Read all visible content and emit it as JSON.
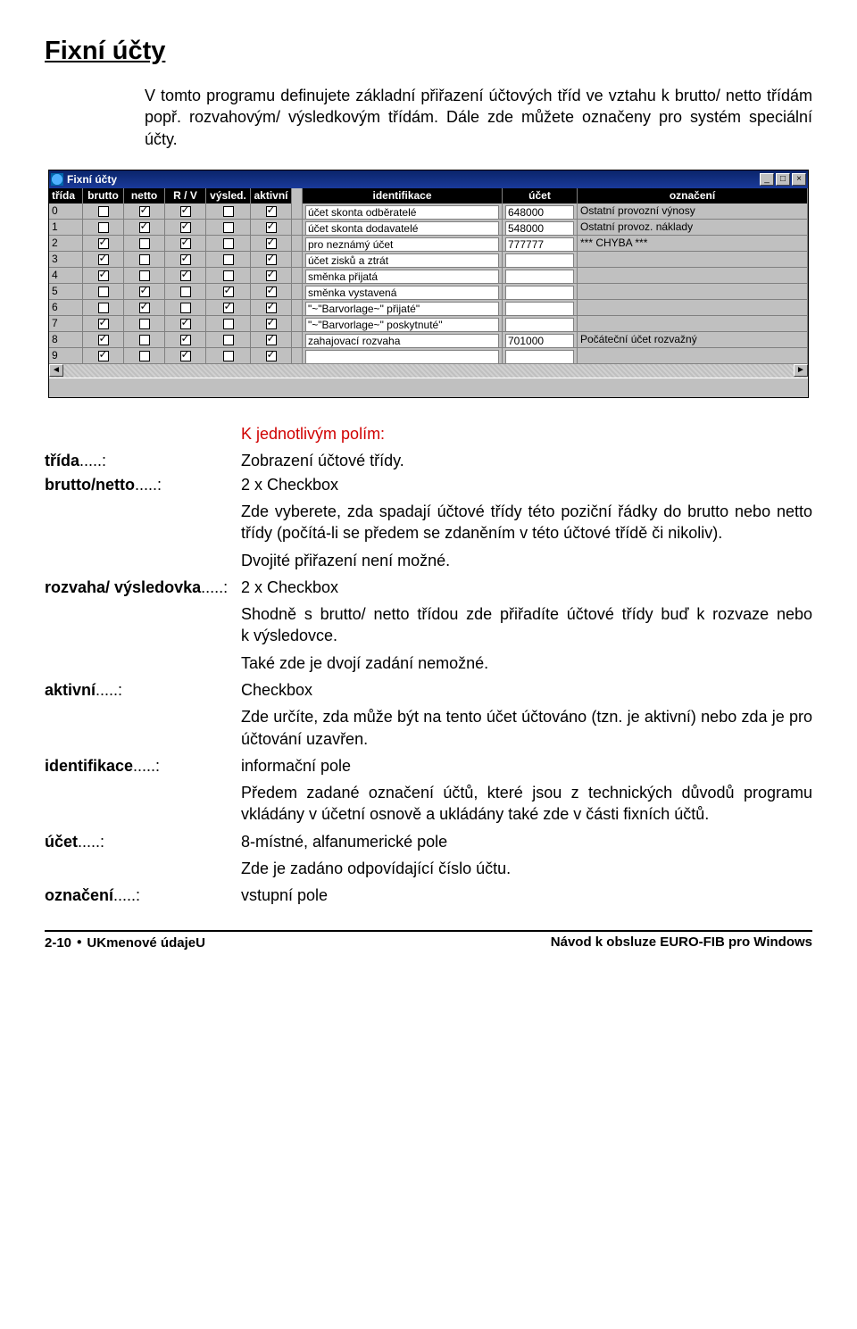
{
  "heading": "Fixní účty",
  "intro": "V tomto programu definujete základní přiřazení účtových tříd ve vztahu k brutto/ netto třídám popř. rozvahovým/ výsledkovým třídám. Dále zde můžete označeny pro systém speciální účty.",
  "window": {
    "title": "Fixní účty",
    "headers": {
      "trida": "třída",
      "brutto": "brutto",
      "netto": "netto",
      "rv": "R / V",
      "vysled": "výsled.",
      "aktivni": "aktivní",
      "ident": "identifikace",
      "ucet": "účet",
      "oznaceni": "označení"
    },
    "rows": [
      {
        "t": "0",
        "b": 0,
        "n": 1,
        "r": 1,
        "v": 0,
        "a": 1,
        "id": "účet skonta odběratelé",
        "uc": "648000",
        "oz": "Ostatní provozní výnosy"
      },
      {
        "t": "1",
        "b": 0,
        "n": 1,
        "r": 1,
        "v": 0,
        "a": 1,
        "id": "účet skonta dodavatelé",
        "uc": "548000",
        "oz": "Ostatní provoz. náklady"
      },
      {
        "t": "2",
        "b": 1,
        "n": 0,
        "r": 1,
        "v": 0,
        "a": 1,
        "id": "pro neznámý účet",
        "uc": "777777",
        "oz": "*** CHYBA ***"
      },
      {
        "t": "3",
        "b": 1,
        "n": 0,
        "r": 1,
        "v": 0,
        "a": 1,
        "id": "účet zisků a ztrát",
        "uc": "",
        "oz": ""
      },
      {
        "t": "4",
        "b": 1,
        "n": 0,
        "r": 1,
        "v": 0,
        "a": 1,
        "id": "směnka přijatá",
        "uc": "",
        "oz": ""
      },
      {
        "t": "5",
        "b": 0,
        "n": 1,
        "r": 0,
        "v": 1,
        "a": 1,
        "id": "směnka vystavená",
        "uc": "",
        "oz": ""
      },
      {
        "t": "6",
        "b": 0,
        "n": 1,
        "r": 0,
        "v": 1,
        "a": 1,
        "id": "\"~\"Barvorlage~\" přijaté\"",
        "uc": "",
        "oz": ""
      },
      {
        "t": "7",
        "b": 1,
        "n": 0,
        "r": 1,
        "v": 0,
        "a": 1,
        "id": "\"~\"Barvorlage~\" poskytnuté\"",
        "uc": "",
        "oz": ""
      },
      {
        "t": "8",
        "b": 1,
        "n": 0,
        "r": 1,
        "v": 0,
        "a": 1,
        "id": "zahajovací rozvaha",
        "uc": "701000",
        "oz": "Počáteční účet rozvažný"
      },
      {
        "t": "9",
        "b": 1,
        "n": 0,
        "r": 1,
        "v": 0,
        "a": 1,
        "id": "",
        "uc": "",
        "oz": ""
      }
    ]
  },
  "defs_heading": "K jednotlivým polím:",
  "defs": {
    "trida": {
      "term": "třída",
      "dots": ".....: ",
      "desc": "Zobrazení účtové třídy."
    },
    "bn": {
      "term": "brutto/netto",
      "dots": ".....: ",
      "desc": "2 x Checkbox"
    },
    "bn_p1": "Zde vyberete, zda spadají účtové třídy této poziční řádky do brutto nebo netto třídy (počítá-li se předem se zdaněním v této účtové třídě či nikoliv).",
    "bn_p2": "Dvojité přiřazení není možné.",
    "rv": {
      "term": "rozvaha/ výsledovka",
      "dots": ".....: ",
      "desc": "2 x Checkbox"
    },
    "rv_p1": "Shodně s brutto/ netto třídou zde přiřadíte účtové třídy buď k rozvaze nebo k výsledovce.",
    "rv_p2": "Také zde je dvojí zadání nemožné.",
    "ak": {
      "term": "aktivní",
      "dots": ".....: ",
      "desc": "Checkbox"
    },
    "ak_p1": "Zde určíte, zda může být na tento účet účtováno (tzn. je aktivní) nebo zda je pro účtování uzavřen.",
    "id": {
      "term": "identifikace",
      "dots": ".....: ",
      "desc": "informační pole"
    },
    "id_p1": "Předem zadané označení účtů, které jsou z technických důvodů programu vkládány v účetní osnově a ukládány také zde v části fixních účtů.",
    "uc": {
      "term": "účet",
      "dots": ".....: ",
      "desc": "8-místné, alfanumerické pole"
    },
    "uc_p1": "Zde je zadáno odpovídající číslo účtu.",
    "oz": {
      "term": "označení",
      "dots": ".....: ",
      "desc": "vstupní pole"
    }
  },
  "footer": {
    "left_a": "2-10 ",
    "left_b": " UKmenové údajeU",
    "right": "Návod k obsluze EURO-FIB pro Windows"
  }
}
